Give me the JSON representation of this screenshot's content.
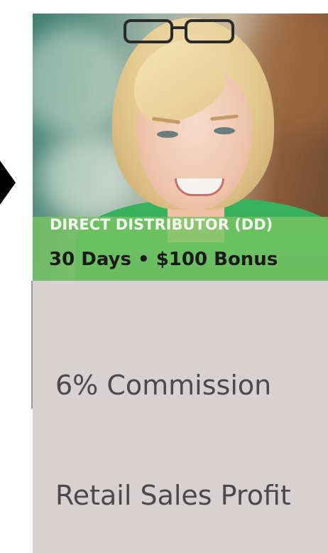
{
  "card": {
    "title": "DIRECT DISTRIBUTOR (DD)",
    "subtitle": "30 Days • $100 Bonus",
    "features": [
      "6% Commission",
      "Retail Sales Profit"
    ]
  },
  "colors": {
    "banner": "#78c464",
    "card_body": "#d7d2d1",
    "feature_text": "#4a4a4a"
  },
  "icons": {
    "left_arrow": "arrow-left-icon"
  }
}
